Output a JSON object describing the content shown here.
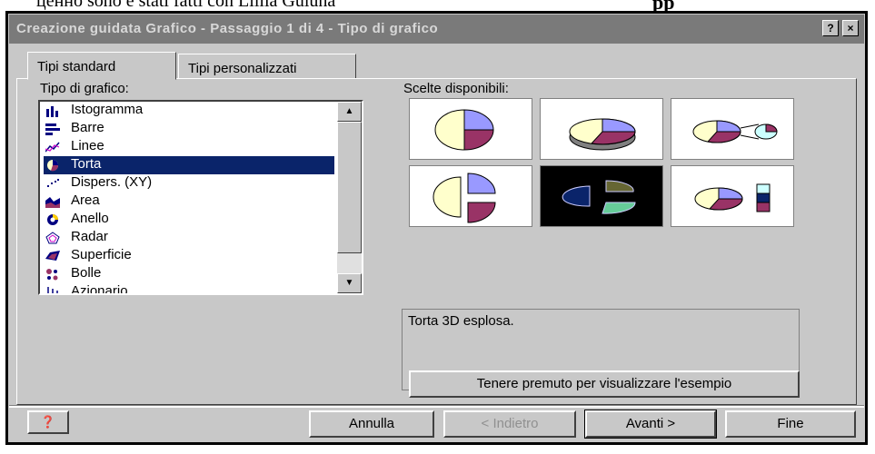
{
  "background": {
    "text_left": "ценно sono e stati fatti con Lillia Guiuna",
    "text_right": "pp"
  },
  "window": {
    "title": "Creazione guidata Grafico - Passaggio 1 di 4 - Tipo di grafico",
    "help_button": "?",
    "close_button": "×"
  },
  "tabs": [
    {
      "label": "Tipi standard"
    },
    {
      "label": "Tipi personalizzati"
    }
  ],
  "chart_type": {
    "label": "Tipo di grafico:",
    "items": [
      {
        "label": "Istogramma",
        "icon": "column-chart-icon"
      },
      {
        "label": "Barre",
        "icon": "bar-chart-icon"
      },
      {
        "label": "Linee",
        "icon": "line-chart-icon"
      },
      {
        "label": "Torta",
        "icon": "pie-chart-icon",
        "selected": true
      },
      {
        "label": "Dispers. (XY)",
        "icon": "scatter-chart-icon"
      },
      {
        "label": "Area",
        "icon": "area-chart-icon"
      },
      {
        "label": "Anello",
        "icon": "doughnut-chart-icon"
      },
      {
        "label": "Radar",
        "icon": "radar-chart-icon"
      },
      {
        "label": "Superficie",
        "icon": "surface-chart-icon"
      },
      {
        "label": "Bolle",
        "icon": "bubble-chart-icon"
      },
      {
        "label": "Azionario",
        "icon": "stock-chart-icon"
      }
    ]
  },
  "subtypes": {
    "label": "Scelte disponibili:",
    "selected_index": 4
  },
  "description": "Torta 3D esplosa.",
  "preview_button": "Tenere premuto per visualizzare l'esempio",
  "footer": {
    "annulla": "Annulla",
    "indietro": "< Indietro",
    "avanti": "Avanti >",
    "fine": "Fine"
  },
  "colors": {
    "selection": "#0a246a",
    "pie_blue": "#9999ff",
    "pie_maroon": "#993366",
    "pie_cream": "#ffffcc",
    "pie_aqua": "#ccffff"
  }
}
